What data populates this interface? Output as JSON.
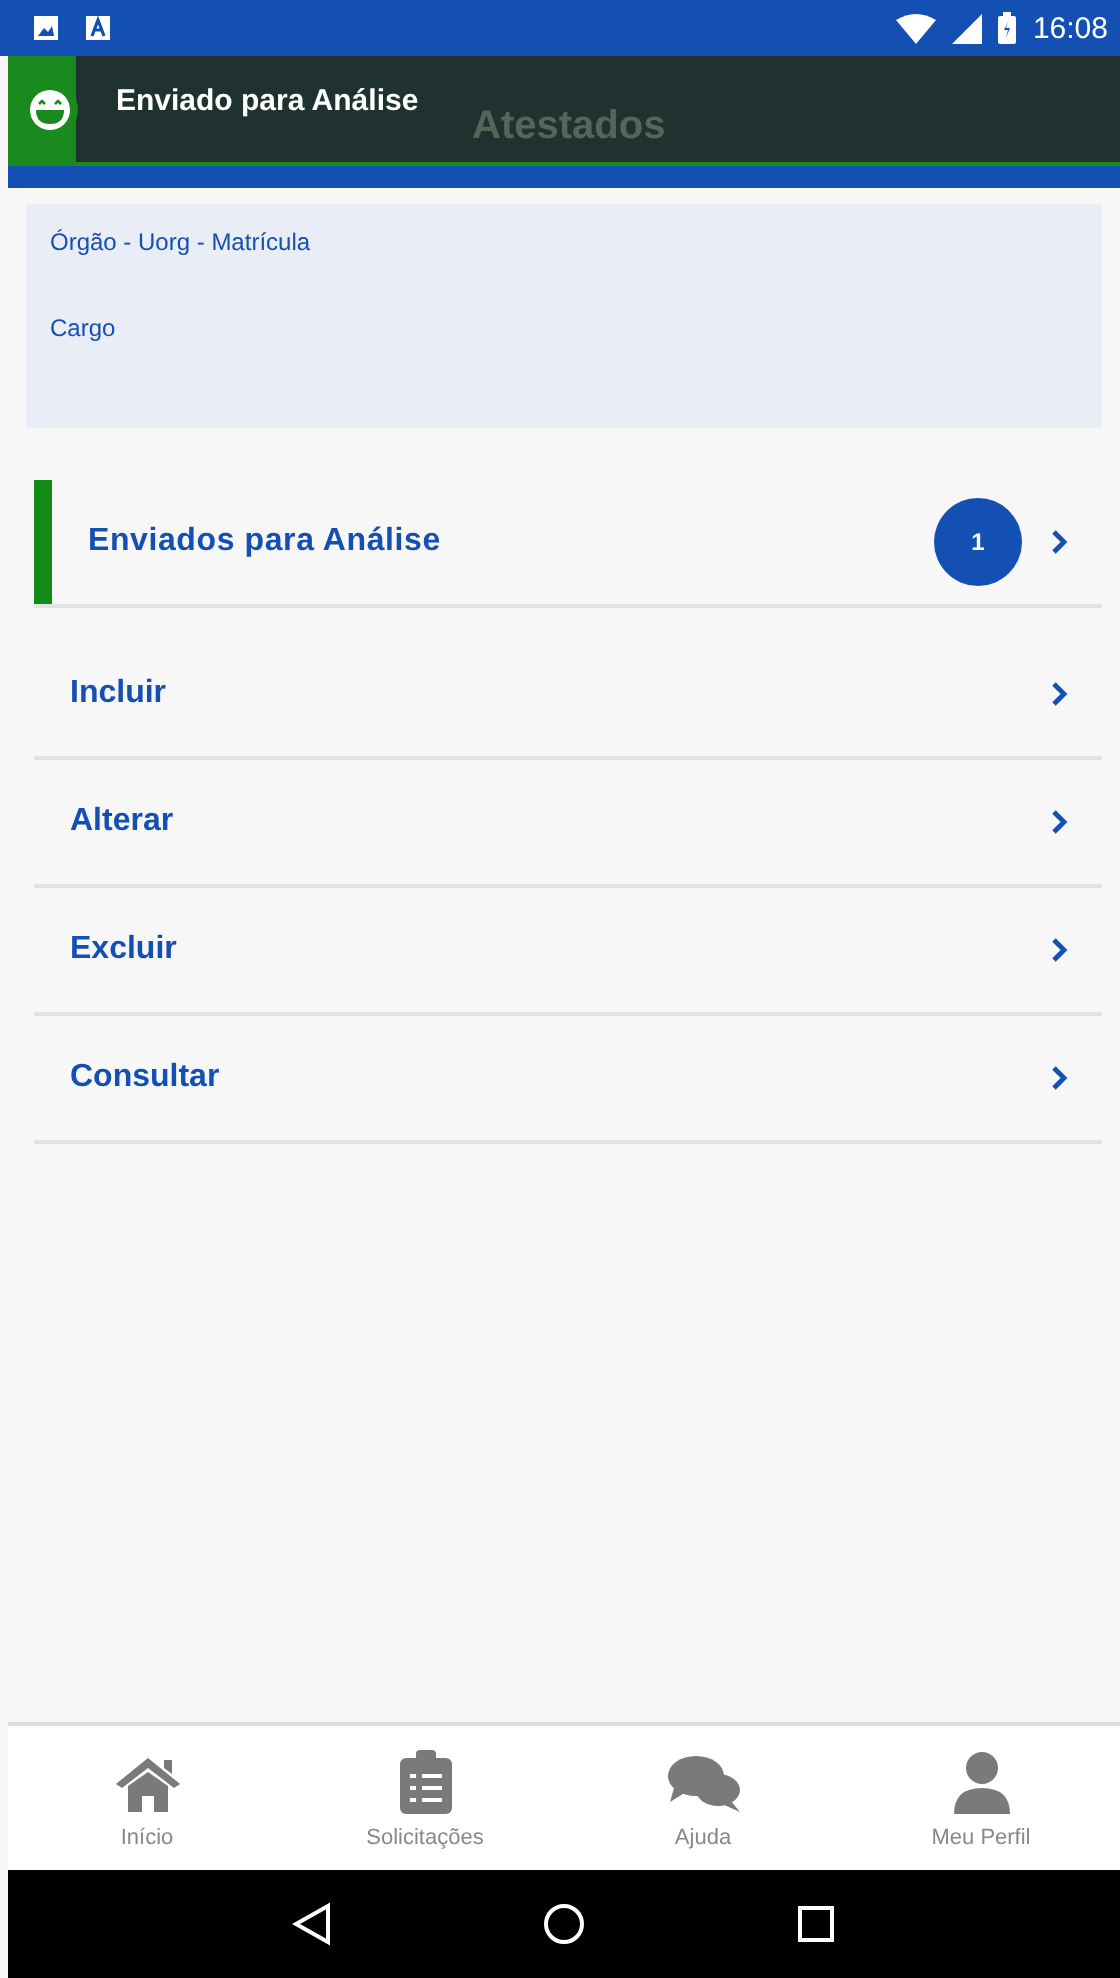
{
  "status_bar": {
    "time": "16:08"
  },
  "header": {
    "title": "Atestados"
  },
  "toast": {
    "message": "Enviado para Análise"
  },
  "profile_card": {
    "lines": [
      "Órgão - Uorg - Matrícula",
      "Cargo"
    ]
  },
  "highlight_item": {
    "label": "Enviados para Análise",
    "count": "1"
  },
  "menu": [
    {
      "label": "Incluir"
    },
    {
      "label": "Alterar"
    },
    {
      "label": "Excluir"
    },
    {
      "label": "Consultar"
    }
  ],
  "bottom_nav": [
    {
      "kind": "home",
      "label": "Início"
    },
    {
      "kind": "clipboard",
      "label": "Solicitações"
    },
    {
      "kind": "chat",
      "label": "Ajuda"
    },
    {
      "kind": "person",
      "label": "Meu Perfil"
    }
  ]
}
